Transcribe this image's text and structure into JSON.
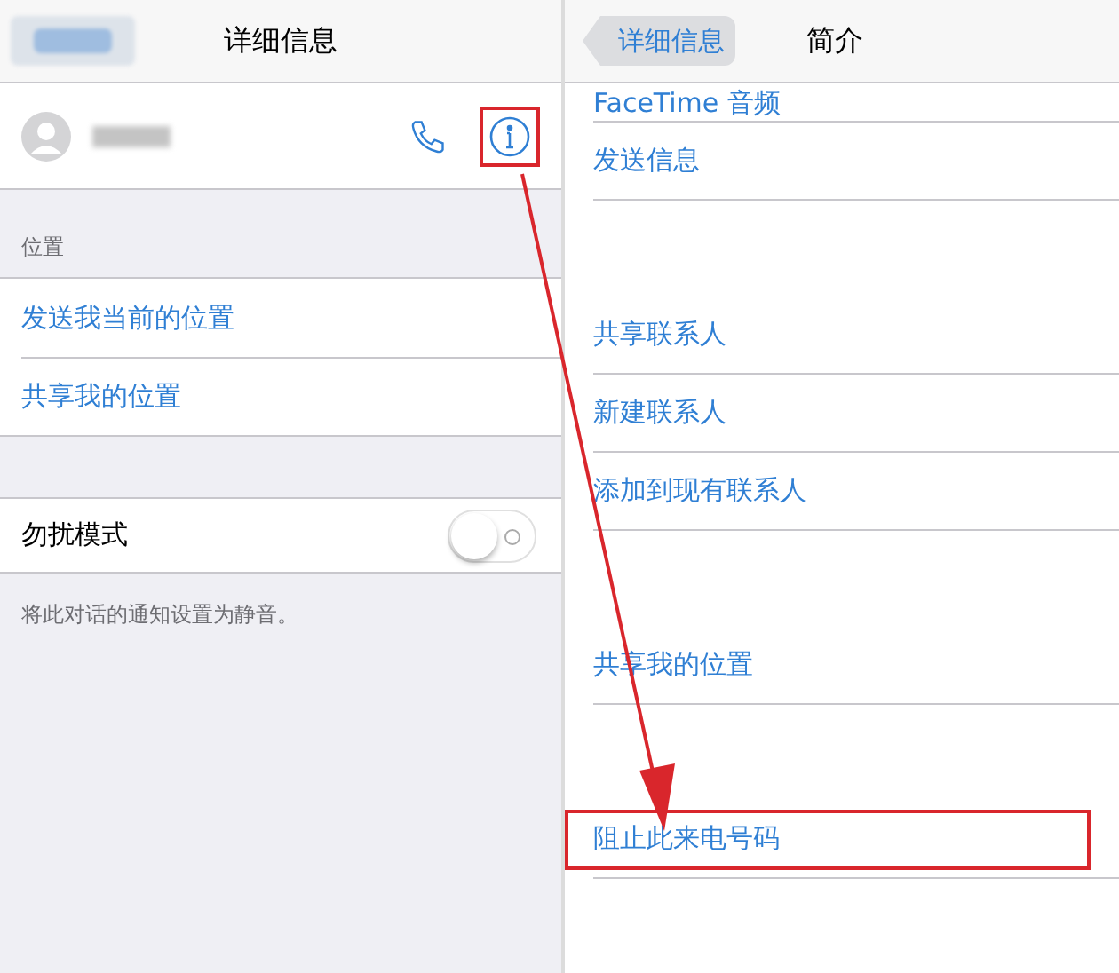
{
  "left_screen": {
    "nav_bar": {
      "title": "详细信息"
    },
    "contact": {
      "info_highlighted": true
    },
    "location_section": {
      "header": "位置",
      "items": [
        "发送我当前的位置",
        "共享我的位置"
      ]
    },
    "do_not_disturb": {
      "label": "勿扰模式",
      "on": false,
      "footnote": "将此对话的通知设置为静音。"
    }
  },
  "right_screen": {
    "nav_bar": {
      "back": "详细信息",
      "title": "简介"
    },
    "items": [
      {
        "label": "FaceTime 音频",
        "kind": "cut"
      },
      {
        "label": "发送信息",
        "kind": "row",
        "highlighted": false
      },
      {
        "kind": "gap"
      },
      {
        "label": "共享联系人",
        "kind": "row",
        "highlighted": false
      },
      {
        "label": "新建联系人",
        "kind": "row",
        "highlighted": false
      },
      {
        "label": "添加到现有联系人",
        "kind": "row",
        "highlighted": false
      },
      {
        "kind": "gap"
      },
      {
        "label": "共享我的位置",
        "kind": "row",
        "highlighted": false
      },
      {
        "kind": "gap"
      },
      {
        "label": "阻止此来电号码",
        "kind": "row",
        "highlighted": true
      }
    ]
  }
}
